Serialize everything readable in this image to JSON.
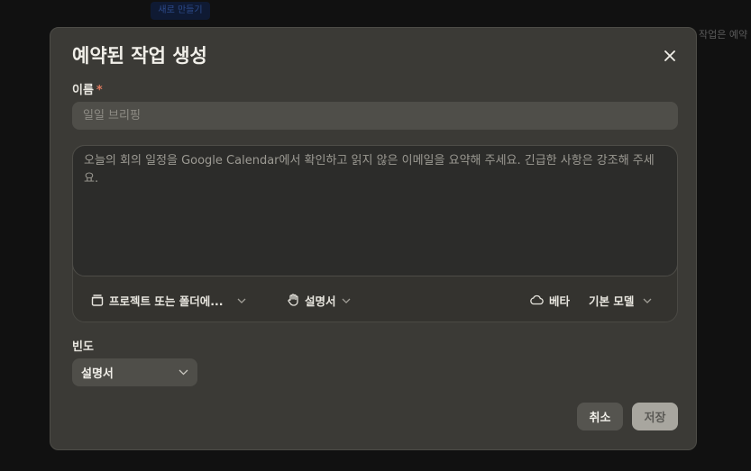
{
  "background": {
    "chip_label": "새로 만들기",
    "side_text": "작업은 예약"
  },
  "dialog": {
    "title": "예약된 작업 생성",
    "close_icon": "close-icon",
    "name": {
      "label": "이름",
      "required_mark": "*",
      "placeholder": "일일 브리핑",
      "value": ""
    },
    "prompt": {
      "placeholder": "오늘의 회의 일정을 Google Calendar에서 확인하고 읽지 않은 이메일을 요약해 주세요. 긴급한 사항은 강조해 주세요."
    },
    "toolbar": {
      "project": {
        "label": "프로젝트 또는 폴더에...",
        "icon": "folder-icon"
      },
      "instructions": {
        "label": "설명서",
        "icon": "hand-icon"
      },
      "beta": {
        "label": "베타",
        "icon": "cloud-icon"
      },
      "model": {
        "label": "기본 모델"
      }
    },
    "frequency": {
      "label": "빈도",
      "selected": "설명서"
    },
    "buttons": {
      "cancel": "취소",
      "save": "저장"
    }
  },
  "colors": {
    "modal_bg": "#3b3a36",
    "input_bg": "#4f4e49",
    "required": "#e07a5f",
    "save_disabled": "#a8a69f"
  }
}
